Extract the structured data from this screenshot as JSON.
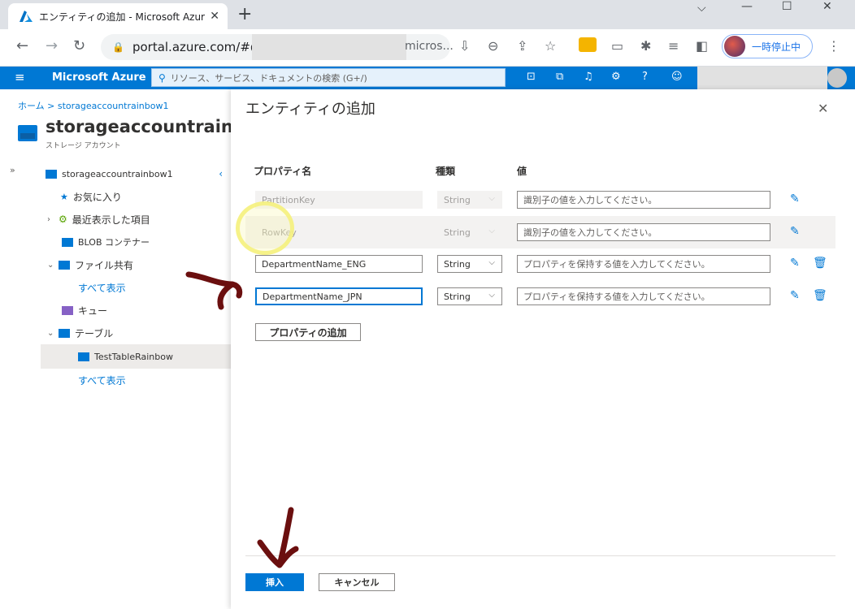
{
  "browser": {
    "tab_title": "エンティティの追加 - Microsoft Azur",
    "url_visible": "portal.azure.com/#@",
    "url_end": "micros...",
    "profile_label": "一時停止中"
  },
  "azure": {
    "brand": "Microsoft Azure",
    "search_placeholder": "リソース、サービス、ドキュメントの検索 (G+/)"
  },
  "left": {
    "breadcrumb": "ホーム > storageaccountrainbow1",
    "account_title": "storageaccountrainbow",
    "account_subtitle": "ストレージ アカウント",
    "tree": {
      "root": "storageaccountrainbow1",
      "favorites": "お気に入り",
      "recent": "最近表示した項目",
      "blob": "BLOB コンテナー",
      "fileshare": "ファイル共有",
      "show_all_1": "すべて表示",
      "queue": "キュー",
      "table": "テーブル",
      "table_item": "TestTableRainbow",
      "show_all_2": "すべて表示"
    }
  },
  "panel": {
    "title": "エンティティの追加",
    "columns": {
      "name": "プロパティ名",
      "type": "種類",
      "value": "値"
    },
    "rows": [
      {
        "name": "PartitionKey",
        "type": "String",
        "value": "識別子の値を入力してください。"
      },
      {
        "name": "RowKey",
        "type": "String",
        "value": "識別子の値を入力してください。"
      },
      {
        "name": "DepartmentName_ENG",
        "type": "String",
        "value": "プロパティを保持する値を入力してください。"
      },
      {
        "name": "DepartmentName_JPN",
        "type": "String",
        "value": "プロパティを保持する値を入力してください。"
      }
    ],
    "add_property": "プロパティの追加",
    "insert": "挿入",
    "cancel": "キャンセル"
  }
}
